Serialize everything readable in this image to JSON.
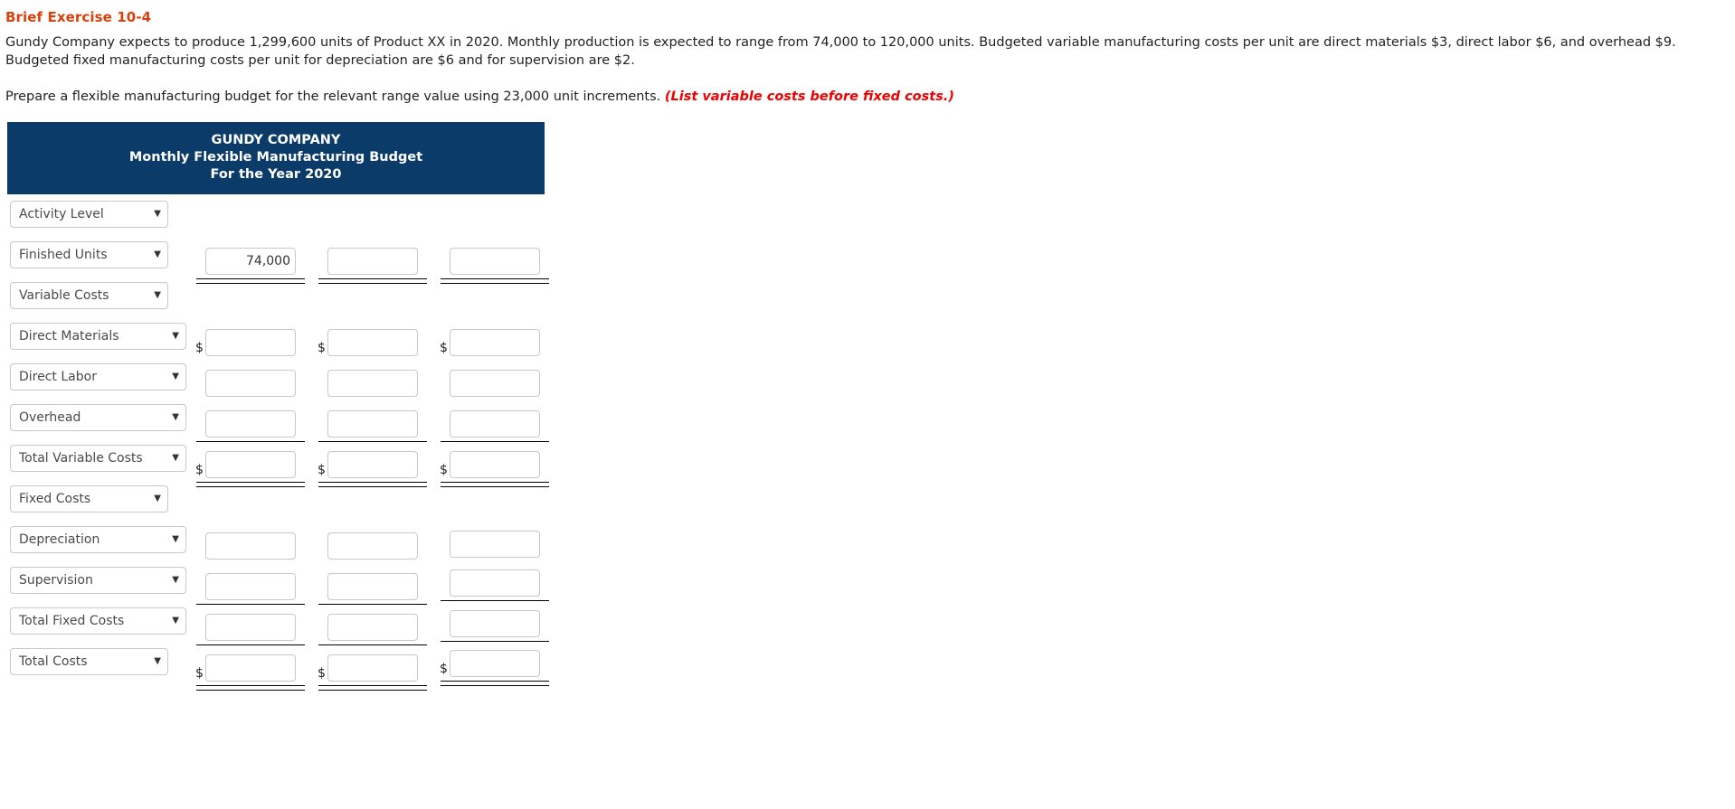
{
  "exercise": {
    "title": "Brief Exercise 10-4",
    "paragraph": "Gundy Company expects to produce 1,299,600 units of Product XX in 2020. Monthly production is expected to range from 74,000 to 120,000 units. Budgeted variable manufacturing costs per unit are direct materials $3, direct labor $6, and overhead $9. Budgeted fixed manufacturing costs per unit for depreciation are $6 and for supervision are $2.",
    "instruction_lead": "Prepare a flexible manufacturing budget for the relevant range value using 23,000 unit increments.",
    "instruction_note": "(List variable costs before fixed costs.)",
    "title_color": "#d9400b",
    "note_color": "#f20000"
  },
  "worksheet": {
    "header": {
      "company": "GUNDY COMPANY",
      "statement": "Monthly Flexible Manufacturing Budget",
      "period": "For the Year 2020",
      "bg_color": "#0b3b68",
      "text_color": "#ffffff"
    },
    "caret_glyph": "▼",
    "dollar_symbol": "$",
    "input_placeholder": "",
    "rows": [
      {
        "id": "activity-level",
        "label": "Activity Level",
        "select_width": "narrow",
        "cells": []
      },
      {
        "id": "finished-units",
        "label": "Finished Units",
        "select_width": "narrow",
        "cells": [
          {
            "value": "74,000",
            "dollar": false,
            "rule_below": "double"
          },
          {
            "value": "",
            "dollar": false,
            "rule_below": "double"
          },
          {
            "value": "",
            "dollar": false,
            "rule_below": "double"
          }
        ]
      },
      {
        "id": "variable-costs",
        "label": "Variable Costs",
        "select_width": "narrow",
        "cells": []
      },
      {
        "id": "direct-materials",
        "label": "Direct Materials",
        "select_width": "wide",
        "cells": [
          {
            "value": "",
            "dollar": true,
            "rule_below": "none"
          },
          {
            "value": "",
            "dollar": true,
            "rule_below": "none"
          },
          {
            "value": "",
            "dollar": true,
            "rule_below": "none"
          }
        ]
      },
      {
        "id": "direct-labor",
        "label": "Direct Labor",
        "select_width": "wide",
        "cells": [
          {
            "value": "",
            "dollar": false,
            "rule_below": "none"
          },
          {
            "value": "",
            "dollar": false,
            "rule_below": "none"
          },
          {
            "value": "",
            "dollar": false,
            "rule_below": "none"
          }
        ]
      },
      {
        "id": "overhead",
        "label": "Overhead",
        "select_width": "wide",
        "cells": [
          {
            "value": "",
            "dollar": false,
            "rule_below": "single"
          },
          {
            "value": "",
            "dollar": false,
            "rule_below": "single"
          },
          {
            "value": "",
            "dollar": false,
            "rule_below": "single"
          }
        ]
      },
      {
        "id": "total-variable-costs",
        "label": "Total Variable Costs",
        "select_width": "wide",
        "cells": [
          {
            "value": "",
            "dollar": true,
            "rule_below": "double"
          },
          {
            "value": "",
            "dollar": true,
            "rule_below": "double"
          },
          {
            "value": "",
            "dollar": true,
            "rule_below": "double"
          }
        ]
      },
      {
        "id": "fixed-costs",
        "label": "Fixed Costs",
        "select_width": "narrow",
        "cells": []
      },
      {
        "id": "depreciation",
        "label": "Depreciation",
        "select_width": "wide",
        "cells": [
          {
            "value": "",
            "dollar": false,
            "rule_below": "none"
          },
          {
            "value": "",
            "dollar": false,
            "rule_below": "none"
          },
          {
            "value": "",
            "dollar": false,
            "rule_below": "none"
          }
        ]
      },
      {
        "id": "supervision",
        "label": "Supervision",
        "select_width": "wide",
        "cells": [
          {
            "value": "",
            "dollar": false,
            "rule_below": "single"
          },
          {
            "value": "",
            "dollar": false,
            "rule_below": "single"
          },
          {
            "value": "",
            "dollar": false,
            "rule_below": "single"
          }
        ]
      },
      {
        "id": "total-fixed-costs",
        "label": "Total Fixed Costs",
        "select_width": "wide",
        "cells": [
          {
            "value": "",
            "dollar": false,
            "rule_below": "single"
          },
          {
            "value": "",
            "dollar": false,
            "rule_below": "single"
          },
          {
            "value": "",
            "dollar": false,
            "rule_below": "single"
          }
        ]
      },
      {
        "id": "total-costs",
        "label": "Total Costs",
        "select_width": "narrow",
        "cells": [
          {
            "value": "",
            "dollar": true,
            "rule_below": "double"
          },
          {
            "value": "",
            "dollar": true,
            "rule_below": "double"
          },
          {
            "value": "",
            "dollar": true,
            "rule_below": "double"
          }
        ]
      }
    ]
  }
}
